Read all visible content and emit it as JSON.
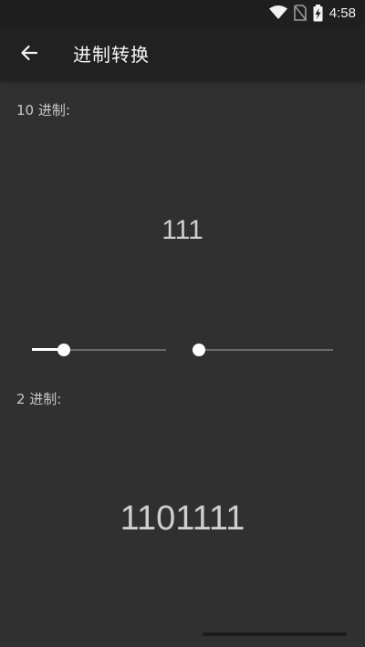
{
  "status_bar": {
    "time": "4:58",
    "icons": [
      "wifi-icon",
      "no-sim-icon",
      "battery-charging-icon"
    ]
  },
  "app_bar": {
    "back_icon": "arrow-left-icon",
    "title": "进制转换"
  },
  "decimal": {
    "label": "10 进制:",
    "value": "111"
  },
  "sliders": [
    {
      "name": "source-base-slider",
      "value": 0.24
    },
    {
      "name": "target-base-slider",
      "value": 0.0
    }
  ],
  "binary": {
    "label": "2 进制:",
    "value": "1101111"
  },
  "colors": {
    "background": "#303030",
    "app_bar": "#212121",
    "text": "#cfcfcf",
    "accent": "#ffffff"
  }
}
